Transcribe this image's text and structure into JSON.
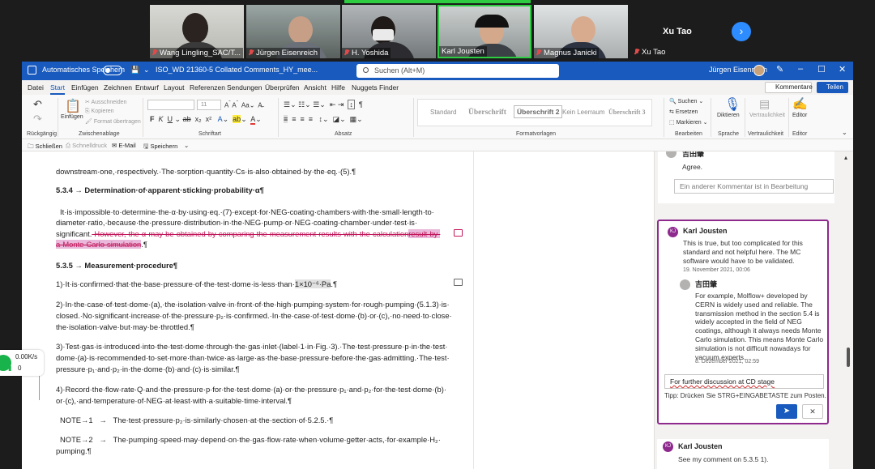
{
  "video": {
    "participants": [
      {
        "name": "Wang Lingling_SAC/T..."
      },
      {
        "name": "Jürgen Eisenreich"
      },
      {
        "name": "H. Yoshida"
      },
      {
        "name": "Karl Jousten"
      },
      {
        "name": "Magnus Janicki"
      }
    ],
    "featured_name": "Xu Tao",
    "featured_sub": "Xu Tao"
  },
  "titlebar": {
    "autosave": "Automatisches Speichern",
    "filename": "ISO_WD 21360-5 Collated Comments_HY_mee...",
    "search_placeholder": "Suchen (Alt+M)",
    "user": "Jürgen Eisenreich"
  },
  "menu": {
    "items": [
      "Datei",
      "Start",
      "Einfügen",
      "Zeichnen",
      "Entwurf",
      "Layout",
      "Referenzen",
      "Sendungen",
      "Überprüfen",
      "Ansicht",
      "Hilfe",
      "Nuggets Finder"
    ],
    "comments_button": "Kommentare",
    "share_button": "Teilen"
  },
  "ribbon": {
    "undo_label": "Rückgängig",
    "paste_label": "Einfügen",
    "cut": "Ausschneiden",
    "copy": "Kopieren",
    "format_painter": "Format übertragen",
    "clipboard_group": "Zwischenablage",
    "font_size": "11",
    "font_group": "Schriftart",
    "paragraph_group": "Absatz",
    "styles": [
      "Standard",
      "Überschrift",
      "Überschrift 2",
      "Kein Leerraum",
      "Überschrift 3"
    ],
    "styles_group": "Formatvorlagen",
    "find": "Suchen",
    "replace": "Ersetzen",
    "select": "Markieren",
    "edit_group": "Bearbeiten",
    "dictate": "Diktieren",
    "speech_group": "Sprache",
    "sensitivity": "Vertraulichkeit",
    "sensitivity_group": "Vertraulichkeit",
    "editor": "Editor",
    "editor_group": "Editor"
  },
  "qat": {
    "close": "Schließen",
    "quickprint": "Schnelldruck",
    "email": "E-Mail",
    "save": "Speichern"
  },
  "document": {
    "line1": "downstream·one,·respectively.·The·sorption·quantity·Cs·is·also·obtained·by·the·eq.·(5).¶",
    "h534": "5.3.4 → Determination·of·apparent·sticking·probability·α¶",
    "p1_l1": "It·is·impossible·to·determine·the·α·by·using·eq.·(7)·except·for·NEG-coating·chambers·with·the·small·length·to·",
    "p1_l2": "diameter·ratio,·because·the·pressure·distribution·in·the·NEG·pump·or·NEG·coating·chamber·under·test·is·",
    "p1_l3a": "significant.",
    "p1_l3b": "·However,·the·α·may·be·obtained·by·comparing·the·measurement·results·with·the·calculation",
    "p1_l3c": "result·by·",
    "p1_l4a": "a·Monte·Carlo·simulation",
    "p1_l4b": ".¶",
    "h535": "5.3.5 → Measurement·procedure¶",
    "s1a": "1)·It·is·confirmed·that·the·base·pressure·of·the·test·dome·is·less·than·",
    "s1b": "1×10⁻⁶·Pa",
    "s1c": ".¶",
    "s2_l1": "2)·In·the·case·of·test·dome·(a),·the·isolation·valve·in·front·of·the·high·pumping·system·for·rough·pumping·(5.1.3)·is·",
    "s2_l2": "closed.·No·significant·increase·of·the·pressure·p₂·is·confirmed.·In·the·case·of·test·dome·(b)·or·(c),·no·need·to·close·",
    "s2_l3": "the·isolation·valve·but·may·be·throttled.¶",
    "s3_l1": "3)·Test·gas·is·introduced·into·the·test·dome·through·the·gas·inlet·(label·1·in·Fig.·3).·The·test·pressure·p·in·the·test·",
    "s3_l2": "dome·(a)·is·recommended·to·set·more·than·twice·as·large·as·the·base·pressure·before·the·gas·admitting.·The·test·",
    "s3_l3": "pressure·p₁·and·p₂·in·the·dome·(b)·and·(c)·is·similar.¶",
    "s4_l1": "4)·Record·the·flow·rate·Q·and·the·pressure·p·for·the·test·dome·(a)·or·the·pressure·p₁·and·p₂·for·the·test·dome·(b)·",
    "s4_l2": "or·(c),·and·temperature·of·NEG·at·least·with·a·suitable·time·interval.¶",
    "n1a": "NOTE→1",
    "n1b": "→",
    "n1c": "The·test·pressure·p₂·is·similarly·chosen·at·the·section·of·5.2.5.·¶",
    "n2a": "NOTE→2",
    "n2b": "→",
    "n2c": "The·pumping·speed·may·depend·on·the·gas·flow·rate·when·volume·getter·acts,·for·example·H₂·",
    "n2d": "pumping.¶"
  },
  "comments": {
    "top": {
      "author": "吉田肇",
      "text": "Agree.",
      "input_placeholder": "Ein anderer Kommentar ist in Bearbeitung"
    },
    "active": {
      "author": "Karl Jousten",
      "initials": "KJ",
      "text": "This is true, but too complicated for this standard and not helpful here. The MC software would have to be validated.",
      "date": "19. November 2021, 00:06",
      "reply_author": "吉田肇",
      "reply_text": "For example, Molflow+ developed by CERN is widely used and reliable. The transmission method in the section 5.4 is widely accepted in the field of NEG coatings, although it always needs Monte Carlo simulation.  This means Monte Carlo simulation is not difficult nowadays for vacuum experts.",
      "reply_date": "8. Dezember 2021, 02:59",
      "draft": "For further discussion at CD stage",
      "tip": "Tipp: Drücken Sie STRG+EINGABETASTE zum Posten."
    },
    "bottom": {
      "author": "Karl Jousten",
      "initials": "KJ",
      "text": "See my comment on 5.3.5 1)."
    }
  },
  "network": {
    "speed": "0.00K/s",
    "count": "0"
  },
  "colors": {
    "word_blue": "#185abd",
    "comment_purple": "#8e2a8e",
    "tracked_change": "#c2185b"
  }
}
